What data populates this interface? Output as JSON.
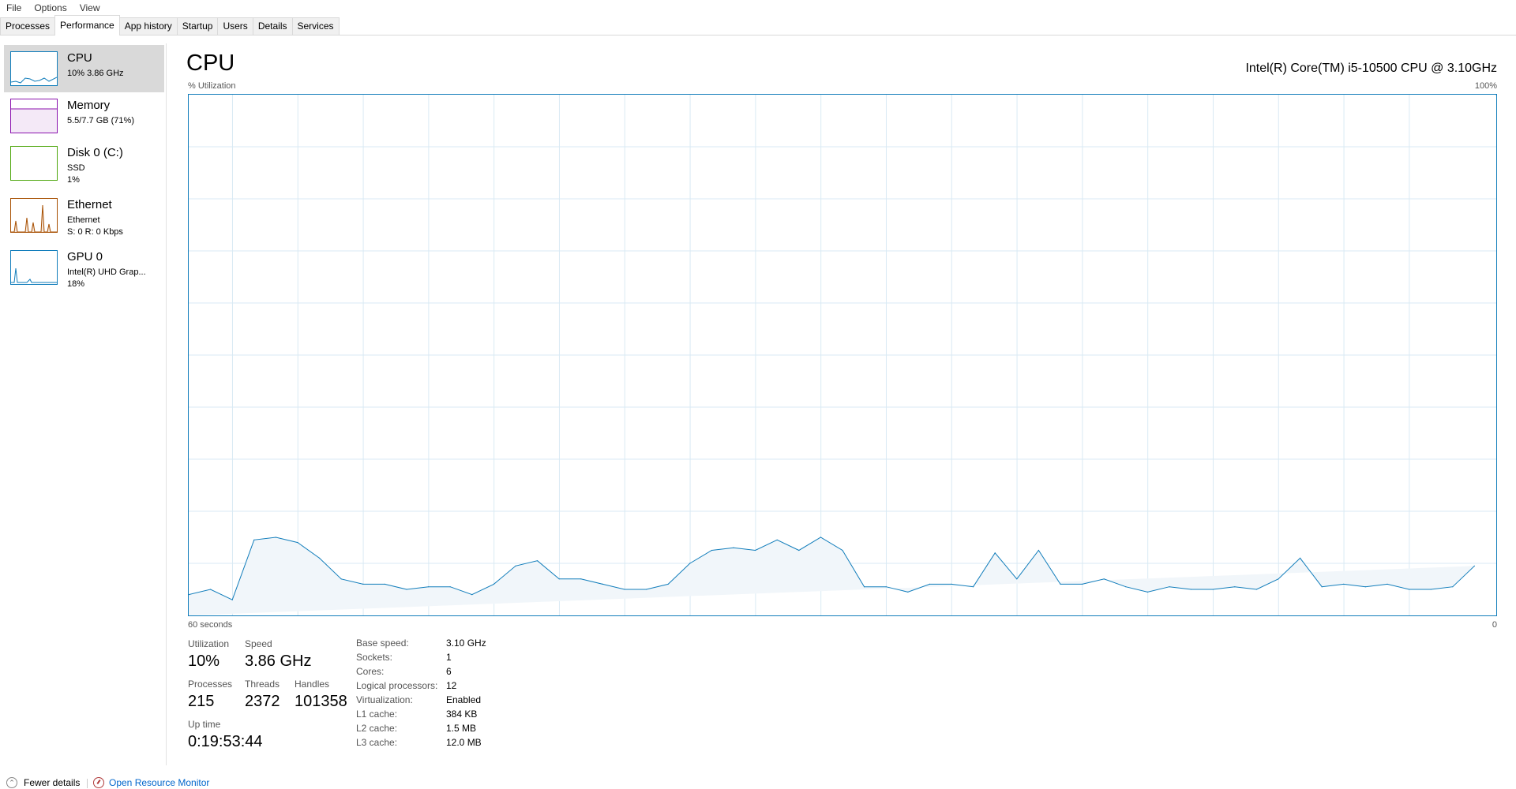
{
  "menu": [
    "File",
    "Options",
    "View"
  ],
  "tabs": [
    "Processes",
    "Performance",
    "App history",
    "Startup",
    "Users",
    "Details",
    "Services"
  ],
  "active_tab": "Performance",
  "sidebar": [
    {
      "title": "CPU",
      "sub1": "10%  3.86 GHz",
      "sub2": "",
      "color": "#117dbb",
      "selected": true
    },
    {
      "title": "Memory",
      "sub1": "5.5/7.7 GB (71%)",
      "sub2": "",
      "color": "#8b12ae",
      "selected": false
    },
    {
      "title": "Disk 0 (C:)",
      "sub1": "SSD",
      "sub2": "1%",
      "color": "#4da60c",
      "selected": false
    },
    {
      "title": "Ethernet",
      "sub1": "Ethernet",
      "sub2": "S: 0  R: 0 Kbps",
      "color": "#a74f01",
      "selected": false
    },
    {
      "title": "GPU 0",
      "sub1": "Intel(R) UHD Grap...",
      "sub2": "18%",
      "color": "#117dbb",
      "selected": false
    }
  ],
  "main": {
    "title": "CPU",
    "cpu_name": "Intel(R) Core(TM) i5-10500 CPU @ 3.10GHz",
    "y_label": "% Utilization",
    "y_max_label": "100%",
    "x_left_label": "60 seconds",
    "x_right_label": "0"
  },
  "chart_data": {
    "type": "area",
    "title": "",
    "xlabel": "60 seconds",
    "ylabel": "% Utilization",
    "ylim": [
      0,
      100
    ],
    "xlim": [
      60,
      0
    ],
    "grid": true,
    "color": "#117dbb",
    "x": [
      60,
      59,
      58,
      57,
      56,
      55,
      54,
      53,
      52,
      51,
      50,
      49,
      48,
      47,
      46,
      45,
      44,
      43,
      42,
      41,
      40,
      39,
      38,
      37,
      36,
      35,
      34,
      33,
      32,
      31,
      30,
      29,
      28,
      27,
      26,
      25,
      24,
      23,
      22,
      21,
      20,
      19,
      18,
      17,
      16,
      15,
      14,
      13,
      12,
      11,
      10,
      9,
      8,
      7,
      6,
      5,
      4,
      3,
      2,
      1,
      0
    ],
    "values": [
      4,
      5,
      3,
      14.5,
      15,
      14,
      11,
      7,
      6,
      6,
      5,
      5.5,
      5.5,
      4,
      6,
      9.5,
      10.5,
      7,
      7,
      6,
      5,
      5,
      6,
      10,
      12.5,
      13,
      12.5,
      14.5,
      12.5,
      15,
      12.5,
      5.5,
      5.5,
      4.5,
      6,
      6,
      5.5,
      12,
      7,
      12.5,
      6,
      6,
      7,
      5.5,
      4.5,
      5.5,
      5,
      5,
      5.5,
      5,
      7,
      11,
      5.5,
      6,
      5.5,
      6,
      5,
      5,
      5.5,
      9.5
    ]
  },
  "stats": {
    "utilization_label": "Utilization",
    "utilization": "10%",
    "speed_label": "Speed",
    "speed": "3.86 GHz",
    "processes_label": "Processes",
    "processes": "215",
    "threads_label": "Threads",
    "threads": "2372",
    "handles_label": "Handles",
    "handles": "101358",
    "uptime_label": "Up time",
    "uptime": "0:19:53:44"
  },
  "specs": [
    {
      "label": "Base speed:",
      "value": "3.10 GHz"
    },
    {
      "label": "Sockets:",
      "value": "1"
    },
    {
      "label": "Cores:",
      "value": "6"
    },
    {
      "label": "Logical processors:",
      "value": "12"
    },
    {
      "label": "Virtualization:",
      "value": "Enabled"
    },
    {
      "label": "L1 cache:",
      "value": "384 KB"
    },
    {
      "label": "L2 cache:",
      "value": "1.5 MB"
    },
    {
      "label": "L3 cache:",
      "value": "12.0 MB"
    }
  ],
  "footer": {
    "fewer_details": "Fewer details",
    "open_resource_monitor": "Open Resource Monitor"
  }
}
